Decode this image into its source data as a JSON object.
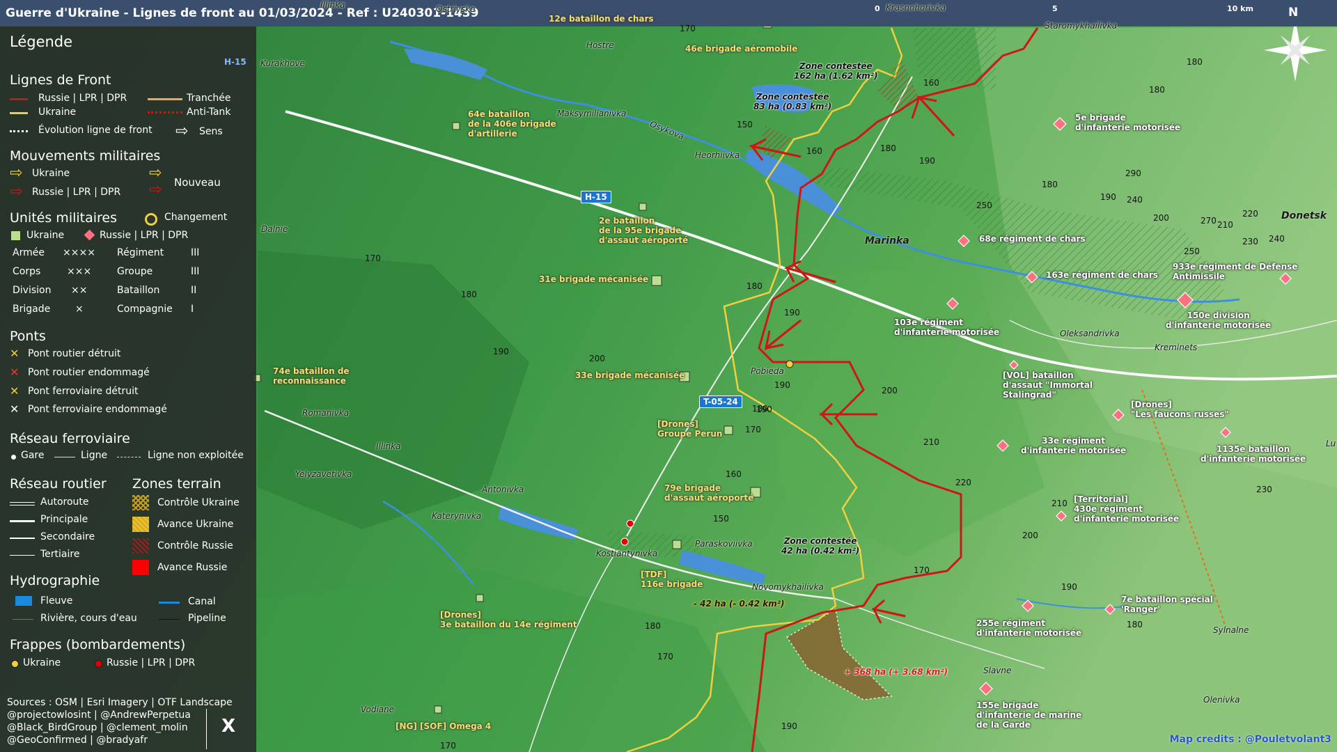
{
  "header": {
    "title": "Guerre d'Ukraine - Lignes de front au 01/03/2024 - Ref : U240301-1439"
  },
  "colors": {
    "russia": "#d01515",
    "ukraine": "#f0d040",
    "ukraine_unit": "#b8e090",
    "russia_unit": "#ff7080",
    "panel_bg": "#2a2a2a",
    "water": "#4a90d9",
    "map_green_dark": "#2f7d3a",
    "map_green_light": "#7fbf6a"
  },
  "legend": {
    "title": "Légende",
    "front_lines": {
      "title": "Lignes de Front",
      "russia": "Russie | LPR | DPR",
      "ukraine": "Ukraine",
      "evolution": "Évolution ligne de front",
      "trench": "Tranchée",
      "antitank": "Anti-Tank",
      "direction": "Sens"
    },
    "movements": {
      "title": "Mouvements militaires",
      "ukraine": "Ukraine",
      "russia": "Russie | LPR | DPR",
      "new": "Nouveau"
    },
    "units": {
      "title": "Unités militaires",
      "change": "Changement",
      "ukraine": "Ukraine",
      "russia": "Russie | LPR | DPR",
      "rows": [
        {
          "a": "Armée",
          "as": "××××",
          "b": "Régiment",
          "bs": "III"
        },
        {
          "a": "Corps",
          "as": "×××",
          "b": "Groupe",
          "bs": "III"
        },
        {
          "a": "Division",
          "as": "××",
          "b": "Bataillon",
          "bs": "II"
        },
        {
          "a": "Brigade",
          "as": "×",
          "b": "Compagnie",
          "bs": "I"
        }
      ]
    },
    "bridges": {
      "title": "Ponts",
      "items": [
        {
          "label": "Pont routier détruit",
          "color": "#f0d040"
        },
        {
          "label": "Pont routier endommagé",
          "color": "#ff3030"
        },
        {
          "label": "Pont ferroviaire détruit",
          "color": "#f0d040"
        },
        {
          "label": "Pont ferroviaire endommagé",
          "color": "#ffffff"
        }
      ]
    },
    "rail": {
      "title": "Réseau ferroviaire",
      "station": "Gare",
      "line": "Ligne",
      "unused": "Ligne non exploitée"
    },
    "roads": {
      "title": "Réseau routier",
      "items": [
        "Autoroute",
        "Principale",
        "Secondaire",
        "Tertiaire"
      ]
    },
    "terrain": {
      "title": "Zones terrain",
      "items": [
        {
          "label": "Contrôle Ukraine",
          "color": "#c8a020"
        },
        {
          "label": "Avance Ukraine",
          "color": "#e8c030"
        },
        {
          "label": "Contrôle Russie",
          "color": "#b01818"
        },
        {
          "label": "Avance Russie",
          "color": "#ff0000"
        }
      ]
    },
    "hydro": {
      "title": "Hydrographie",
      "river": "Fleuve",
      "canal": "Canal",
      "stream": "Rivière, cours d'eau",
      "pipeline": "Pipeline"
    },
    "strikes": {
      "title": "Frappes (bombardements)",
      "ukraine": "Ukraine",
      "russia": "Russie | LPR | DPR"
    },
    "sources": [
      "Sources : OSM | Esri Imagery | OTF Landscape",
      "@projectowlosint | @AndrewPerpetua",
      "@Black_BirdGroup | @clement_molin",
      "@GeoConfirmed | @bradyafr"
    ],
    "x_logo": "X"
  },
  "scalebar": {
    "t0": "0",
    "t5": "5",
    "t10": "10 km"
  },
  "north": "N",
  "credits": "Map credits : @Pouletvolant3",
  "towns": [
    {
      "name": "Krasnohorivka",
      "bold": false
    },
    {
      "name": "Ostrivske",
      "bold": false
    },
    {
      "name": "Illinka",
      "bold": false
    },
    {
      "name": "Kurakhove",
      "bold": false
    },
    {
      "name": "Hostre",
      "bold": false
    },
    {
      "name": "Maksymilianivka",
      "bold": false
    },
    {
      "name": "Heorhiivka",
      "bold": false
    },
    {
      "name": "Marinka",
      "bold": true
    },
    {
      "name": "Dalnie",
      "bold": false
    },
    {
      "name": "Pobieda",
      "bold": false
    },
    {
      "name": "Oleksandrivka",
      "bold": false
    },
    {
      "name": "Kreminets",
      "bold": false
    },
    {
      "name": "Romanivka",
      "bold": false
    },
    {
      "name": "Illinka",
      "bold": false
    },
    {
      "name": "Yelyzavetivka",
      "bold": false
    },
    {
      "name": "Antonivka",
      "bold": false
    },
    {
      "name": "Katerynivka",
      "bold": false
    },
    {
      "name": "Kostiantynivka",
      "bold": false
    },
    {
      "name": "Paraskoviivka",
      "bold": false
    },
    {
      "name": "Novomykhailivka",
      "bold": false
    },
    {
      "name": "Vodiane",
      "bold": false
    },
    {
      "name": "Slavne",
      "bold": false
    },
    {
      "name": "Sylnalne",
      "bold": false
    },
    {
      "name": "Olenivka",
      "bold": false
    },
    {
      "name": "Donetsk",
      "bold": true
    },
    {
      "name": "Staromykhailivka",
      "bold": false
    },
    {
      "name": "Osykova",
      "bold": false
    },
    {
      "name": "Lu",
      "bold": false
    }
  ],
  "roads_labels": [
    "H-15",
    "T-05-24",
    "H-15"
  ],
  "zones": [
    "Zone contestée\n162 ha (1.62 km²)",
    "Zone contestée\n83 ha (0.83 km²)",
    "Zone contestée\n42 ha (0.42 km²)"
  ],
  "changes": {
    "ukr_loss": "- 42 ha (- 0.42 km²)",
    "rus_gain": "+ 368 ha (+ 3.68 km²)"
  },
  "units_ukr": [
    "12e bataillon de chars",
    "46e brigade aéromobile",
    "64e bataillon\nde la 406e brigade\nd'artillerie",
    "2e bataillon\nde la 95e brigade\nd'assaut aéroporté",
    "31e brigade mécanisée",
    "74e bataillon de\nreconnaissance",
    "33e brigade mécanisée",
    "[Drones]\nGroupe Perun",
    "79e brigade\nd'assaut aéroporté",
    "[TDF]\n116e brigade",
    "[Drones]\n3e bataillon du 14e régiment",
    "[NG] [SOF] Omega 4"
  ],
  "units_rus": [
    "5e brigade\nd'infanterie motorisée",
    "68e régiment de chars",
    "163e régiment de chars",
    "933e régiment de Défense\nAntimissile",
    "150e division\nd'infanterie motorisée",
    "103e régiment\nd'infanterie motorisée",
    "[VOL] bataillon\nd'assaut \"Immortal\nStalingrad\"",
    "[Drones]\n\"Les faucons russes\"",
    "33e régiment\nd'infanterie motorisée",
    "1135e bataillon\nd'infanterie motorisée",
    "[Territorial]\n430e régiment\nd'infanterie motorisée",
    "7e bataillon spécial\n'Ranger'",
    "255e régiment\nd'infanterie motorisée",
    "155e brigade\nd'infanterie de marine\nde la Garde"
  ],
  "elevations": [
    "170",
    "180",
    "160",
    "150",
    "160",
    "180",
    "190",
    "180",
    "250",
    "190",
    "240",
    "200",
    "270",
    "210",
    "220",
    "230",
    "240",
    "290",
    "250",
    "180",
    "190",
    "170",
    "180",
    "190",
    "180",
    "200",
    "190",
    "180",
    "170",
    "200",
    "210",
    "220",
    "230",
    "210",
    "200",
    "160",
    "150",
    "170",
    "190",
    "180",
    "170",
    "190",
    "180",
    "190",
    "170"
  ]
}
